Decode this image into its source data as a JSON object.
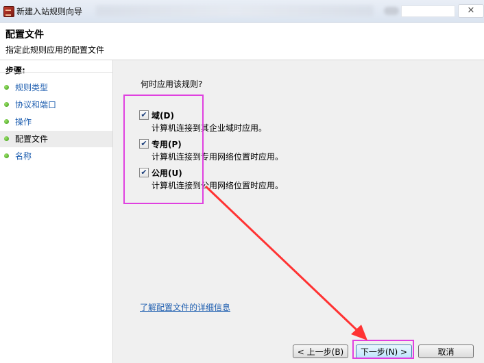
{
  "window": {
    "title": "新建入站规则向导",
    "close_glyph": "✕"
  },
  "header": {
    "title": "配置文件",
    "description": "指定此规则应用的配置文件"
  },
  "sidebar": {
    "steps_title": "步骤:",
    "items": [
      {
        "label": "规则类型",
        "active": false
      },
      {
        "label": "协议和端口",
        "active": false
      },
      {
        "label": "操作",
        "active": false
      },
      {
        "label": "配置文件",
        "active": true
      },
      {
        "label": "名称",
        "active": false
      }
    ]
  },
  "main": {
    "question": "何时应用该规则?",
    "options": [
      {
        "label": "域(D)",
        "description": "计算机连接到其企业域时应用。",
        "checked": true
      },
      {
        "label": "专用(P)",
        "description": "计算机连接到专用网络位置时应用。",
        "checked": true
      },
      {
        "label": "公用(U)",
        "description": "计算机连接到公用网络位置时应用。",
        "checked": true
      }
    ],
    "learn_more": "了解配置文件的详细信息"
  },
  "buttons": {
    "back": "< 上一步(B)",
    "next": "下一步(N) >",
    "cancel": "取消"
  },
  "colors": {
    "highlight": "#e040e0",
    "arrow": "#ff3333",
    "link": "#1f5fb0"
  },
  "icons": {
    "app": "firewall-icon",
    "step_bullet": "green-dot-icon",
    "checkmark": "checkmark-icon"
  }
}
